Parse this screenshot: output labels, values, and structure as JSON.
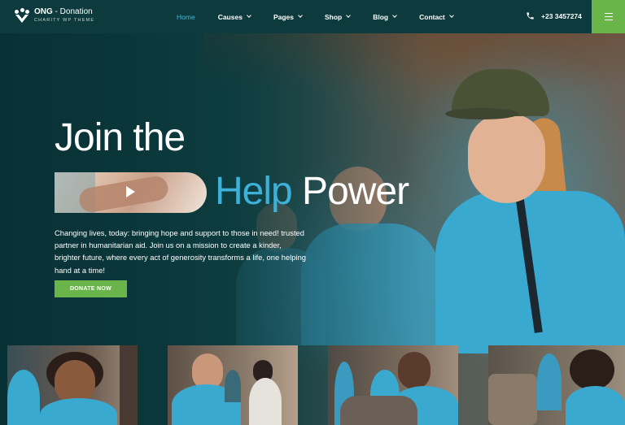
{
  "header": {
    "logo": {
      "brand": "ONG",
      "suffix": " - Donation",
      "tagline": "CHARITY WP THEME",
      "icon": "paw-hands-logo-icon"
    },
    "nav": [
      {
        "label": "Home",
        "active": true,
        "dropdown": false
      },
      {
        "label": "Causes",
        "active": false,
        "dropdown": true
      },
      {
        "label": "Pages",
        "active": false,
        "dropdown": true
      },
      {
        "label": "Shop",
        "active": false,
        "dropdown": true
      },
      {
        "label": "Blog",
        "active": false,
        "dropdown": true
      },
      {
        "label": "Contact",
        "active": false,
        "dropdown": true
      }
    ],
    "phone": {
      "icon": "phone-icon",
      "number": "+23 3457274"
    },
    "menu_icon": "hamburger-icon"
  },
  "hero": {
    "line1": "Join the",
    "line2_accent": "Help",
    "line2_rest": " Power",
    "video_icon": "play-icon",
    "description": "Changing lives, today: bringing hope and support to those in need! trusted partner in humanitarian aid. Join us on a mission to create a kinder, brighter future, where every act of generosity transforms a life, one helping hand at a time!",
    "cta": "DONATE NOW"
  },
  "colors": {
    "header_bg": "#0d3a3c",
    "accent_blue": "#3db1d8",
    "accent_green": "#6ab54a",
    "text": "#ffffff"
  }
}
